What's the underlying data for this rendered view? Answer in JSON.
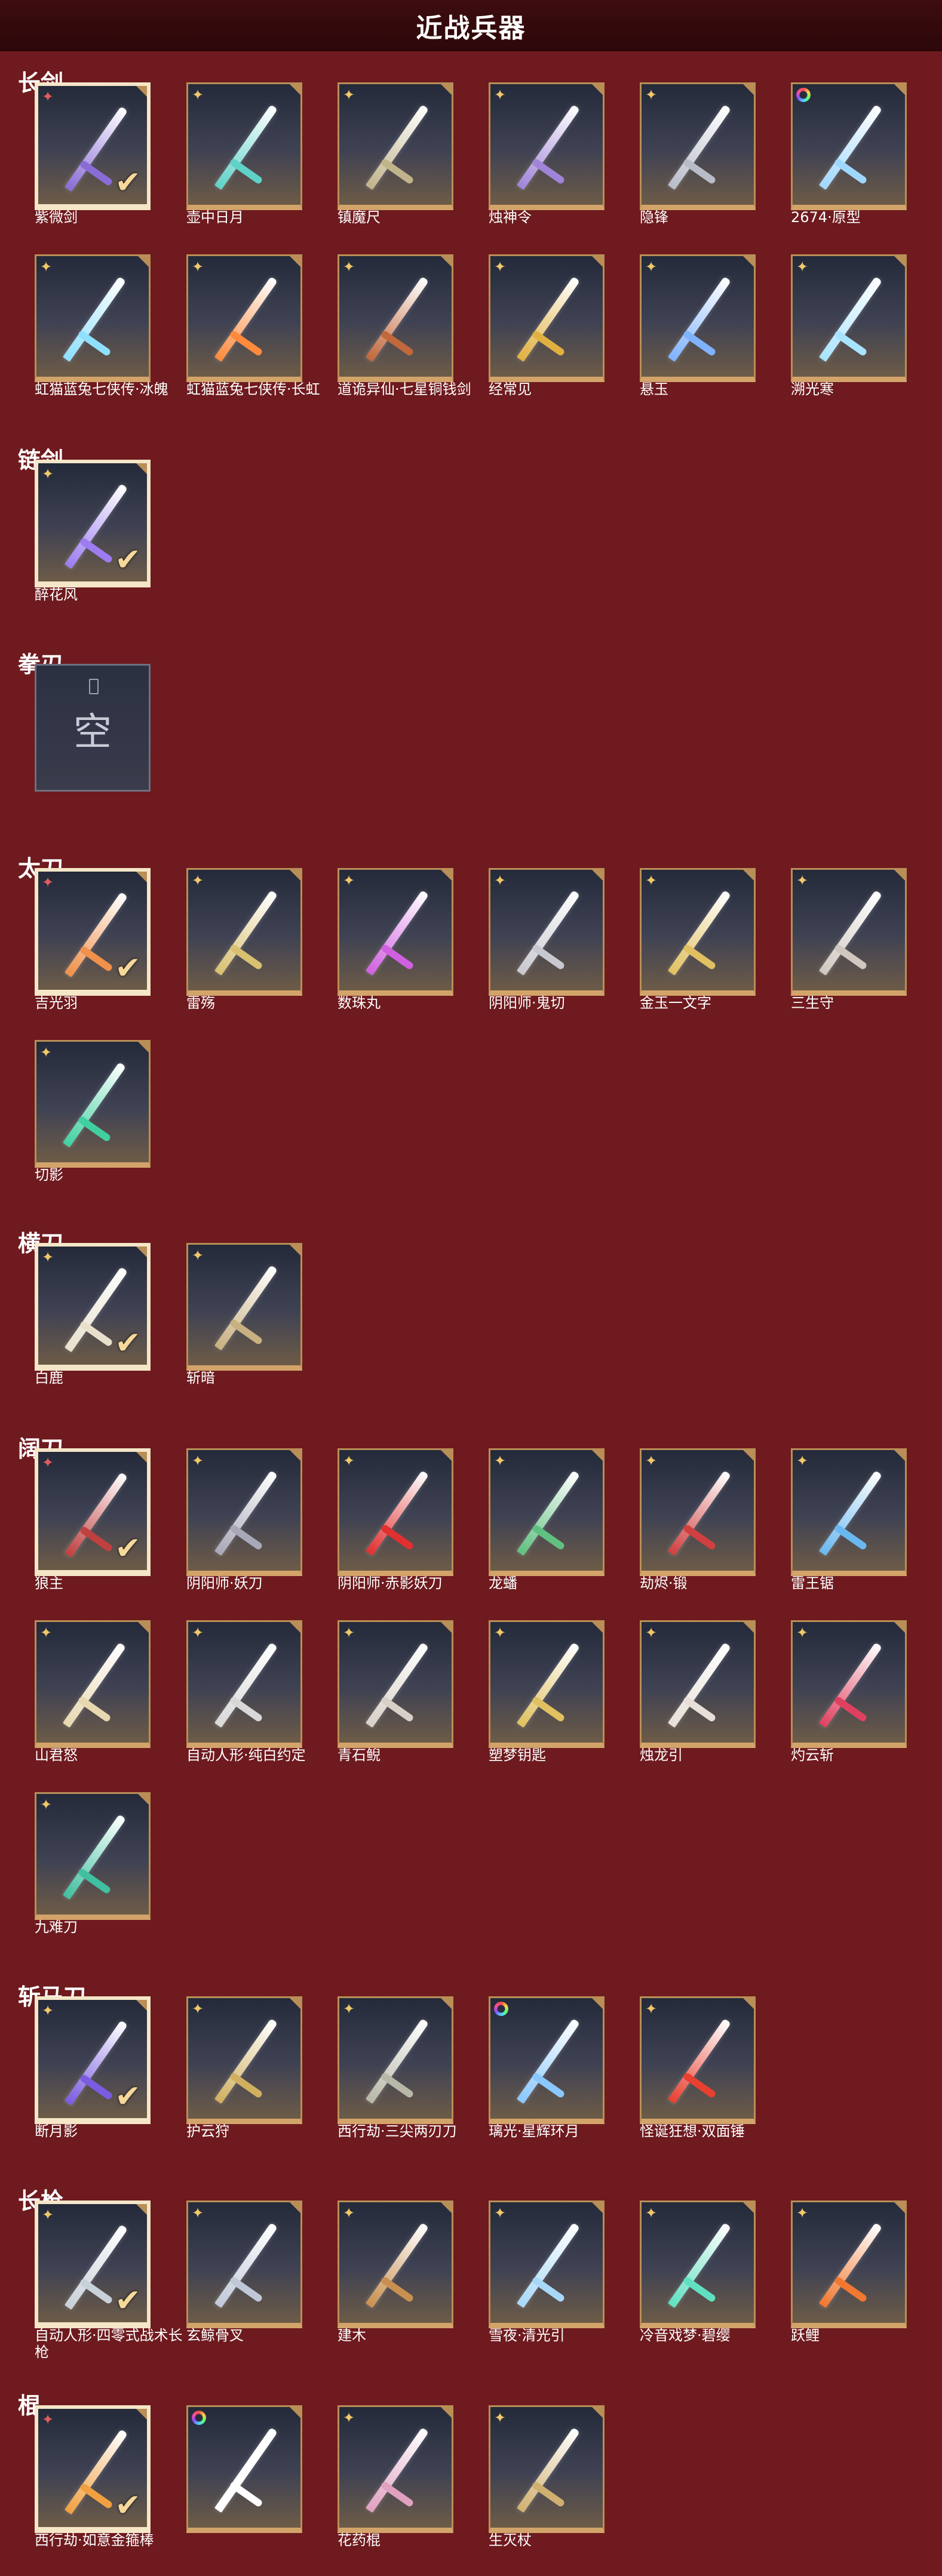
{
  "page": {
    "title": "近战兵器"
  },
  "categories": [
    {
      "id": "changjian",
      "name": "长剑",
      "items": [
        {
          "name": "紫微剑",
          "tier": "red",
          "selected": true,
          "color": "#8a6cd6"
        },
        {
          "name": "壶中日月",
          "tier": "gold",
          "color": "#5fd2c8"
        },
        {
          "name": "镇魔尺",
          "tier": "gold",
          "color": "#c0b48a"
        },
        {
          "name": "烛神令",
          "tier": "gold",
          "color": "#a084d8"
        },
        {
          "name": "隐锋",
          "tier": "gold",
          "color": "#b8bcc8"
        },
        {
          "name": "2674·原型",
          "tier": "rainbow",
          "color": "#9fd8ff"
        },
        {
          "name": "虹猫蓝兔七侠传·冰魄",
          "tier": "gold",
          "color": "#8fe0ff"
        },
        {
          "name": "虹猫蓝兔七侠传·长虹",
          "tier": "gold",
          "color": "#ff8a3c"
        },
        {
          "name": "道诡异仙·七星铜钱剑",
          "tier": "gold",
          "color": "#c2683c"
        },
        {
          "name": "经常见",
          "tier": "gold",
          "color": "#e0b040"
        },
        {
          "name": "悬玉",
          "tier": "gold",
          "color": "#7fb2ff"
        },
        {
          "name": "溯光寒",
          "tier": "gold",
          "color": "#a8e4ff"
        }
      ]
    },
    {
      "id": "lianjian",
      "name": "链剑",
      "items": [
        {
          "name": "醉花风",
          "tier": "gold",
          "selected": true,
          "color": "#9c7cf0"
        }
      ]
    },
    {
      "id": "quanren",
      "name": "拳刃",
      "items": [
        {
          "name": "",
          "empty": true,
          "empty_label": "空"
        }
      ]
    },
    {
      "id": "taidao",
      "name": "太刀",
      "items": [
        {
          "name": "吉光羽",
          "tier": "red",
          "selected": true,
          "color": "#f0904a"
        },
        {
          "name": "雷殇",
          "tier": "gold",
          "color": "#d8c070"
        },
        {
          "name": "数珠丸",
          "tier": "gold",
          "color": "#d060e0"
        },
        {
          "name": "阴阳师·鬼切",
          "tier": "gold",
          "color": "#c8c8d0"
        },
        {
          "name": "金玉一文字",
          "tier": "gold",
          "color": "#e0c060"
        },
        {
          "name": "三生守",
          "tier": "gold",
          "color": "#d0c8c0"
        },
        {
          "name": "切影",
          "tier": "gold",
          "color": "#40d0a0"
        }
      ]
    },
    {
      "id": "hengdao",
      "name": "横刀",
      "items": [
        {
          "name": "白鹿",
          "tier": "gold",
          "selected": true,
          "color": "#e8e0cc"
        },
        {
          "name": "斩暗",
          "tier": "gold",
          "color": "#c8b080"
        }
      ]
    },
    {
      "id": "kuodao",
      "name": "阔刀",
      "items": [
        {
          "name": "狼主",
          "tier": "red",
          "selected": true,
          "color": "#c04040"
        },
        {
          "name": "阴阳师·妖刀",
          "tier": "gold",
          "color": "#a8a8b8"
        },
        {
          "name": "阴阳师·赤影妖刀",
          "tier": "gold",
          "color": "#e03030"
        },
        {
          "name": "龙蟠",
          "tier": "gold",
          "color": "#60c080"
        },
        {
          "name": "劫烬·锻",
          "tier": "gold",
          "color": "#d04040"
        },
        {
          "name": "雷王锯",
          "tier": "gold",
          "color": "#6ab8f0"
        },
        {
          "name": "山君怒",
          "tier": "gold",
          "color": "#e8d8b0"
        },
        {
          "name": "自动人形·纯白约定",
          "tier": "gold",
          "color": "#d8d8d8"
        },
        {
          "name": "青石鲵",
          "tier": "gold",
          "color": "#d8d0c8"
        },
        {
          "name": "塑梦钥匙",
          "tier": "gold",
          "color": "#e0c060"
        },
        {
          "name": "烛龙引",
          "tier": "gold",
          "color": "#e8e0d8"
        },
        {
          "name": "灼云斩",
          "tier": "gold",
          "color": "#e04060"
        },
        {
          "name": "九难刀",
          "tier": "gold",
          "color": "#40c0a0"
        }
      ]
    },
    {
      "id": "zhanmadao",
      "name": "斩马刀",
      "items": [
        {
          "name": "断月影",
          "tier": "gold",
          "selected": true,
          "color": "#7a5ce0"
        },
        {
          "name": "护云狩",
          "tier": "gold",
          "color": "#d0b060"
        },
        {
          "name": "西行劫·三尖两刃刀",
          "tier": "gold",
          "color": "#b8b8a8"
        },
        {
          "name": "璃光·星辉环月",
          "tier": "rainbow",
          "color": "#8ac8ff"
        },
        {
          "name": "怪诞狂想·双面锤",
          "tier": "gold",
          "color": "#e84030"
        }
      ]
    },
    {
      "id": "changqiang",
      "name": "长枪",
      "items": [
        {
          "name": "自动人形·四零式战术长枪",
          "tier": "gold",
          "selected": true,
          "color": "#c8d0d8"
        },
        {
          "name": "玄鲸骨叉",
          "tier": "gold",
          "color": "#c0c8d8"
        },
        {
          "name": "建木",
          "tier": "gold",
          "color": "#c89050"
        },
        {
          "name": "雪夜·清光引",
          "tier": "gold",
          "color": "#a8d8f8"
        },
        {
          "name": "冷音戏梦·碧缨",
          "tier": "gold",
          "color": "#60e0c0"
        },
        {
          "name": "跃鲤",
          "tier": "gold",
          "color": "#f07830"
        }
      ]
    },
    {
      "id": "gun",
      "name": "棍",
      "items": [
        {
          "name": "西行劫·如意金箍棒",
          "tier": "red",
          "selected": true,
          "color": "#f0a040"
        },
        {
          "name": "",
          "tier": "rainbow",
          "color": "#ffffff"
        },
        {
          "name": "花药棍",
          "tier": "gold",
          "color": "#e0a0c0"
        },
        {
          "name": "生灭杖",
          "tier": "gold",
          "color": "#d0b070"
        }
      ]
    }
  ]
}
